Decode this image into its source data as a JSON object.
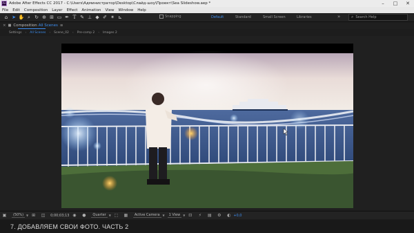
{
  "window": {
    "title": "Adobe After Effects CC 2017 - C:\\Users\\Администратор\\Desktop\\Слайд-шоу\\Проект\\Sea Slideshow.aep *",
    "icon_label": "Ae",
    "controls": {
      "minimize": "–",
      "maximize": "□",
      "close": "✕"
    }
  },
  "menu": [
    "File",
    "Edit",
    "Composition",
    "Layer",
    "Effect",
    "Animation",
    "View",
    "Window",
    "Help"
  ],
  "toolbar": {
    "tools": [
      "selection-tool",
      "hand-tool",
      "zoom-tool",
      "rotate-tool",
      "orbit-camera-tool",
      "pan-behind-tool",
      "rectangle-tool",
      "pen-tool",
      "type-tool",
      "brush-tool",
      "clone-stamp-tool",
      "eraser-tool",
      "roto-brush-tool",
      "puppet-pin-tool"
    ],
    "snapping_label": "Snapping",
    "workspaces": [
      "Default",
      "Standard",
      "Small Screen",
      "Libraries"
    ],
    "active_workspace": "Default",
    "more": "»",
    "search_placeholder": "Search Help"
  },
  "comp_panel": {
    "close": "×",
    "label": "Composition",
    "name": "All Scenes",
    "menu": "≡"
  },
  "flowchart": {
    "items": [
      "Settings",
      "All Scenes",
      "Scene_02",
      "Pre-comp 2",
      "Images 2"
    ],
    "current": "All Scenes",
    "separator": "‹"
  },
  "viewer_bar": {
    "magnification": "(50%)",
    "timecode": "0;00;03;13",
    "resolution": "Quarter",
    "view": "Active Camera",
    "views_count": "1 View",
    "exposure": "+0,0"
  },
  "caption": "7. ДОБАВЛЯЕМ СВОИ ФОТО. ЧАСТЬ 2",
  "colors": {
    "accent": "#3d8ef0",
    "panel": "#232323",
    "background": "#1d1d1d"
  }
}
